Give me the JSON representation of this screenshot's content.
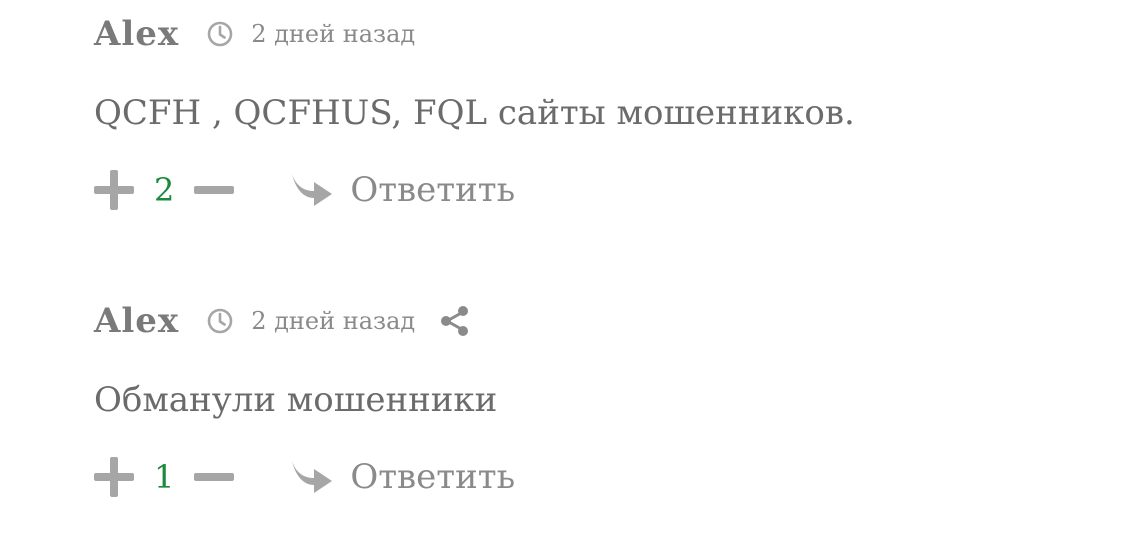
{
  "comments": [
    {
      "author": "Alex",
      "time": "2 дней назад",
      "text": "QCFH , QCFHUS, FQL сайты мошенников.",
      "score": "2",
      "reply_label": "Ответить"
    },
    {
      "author": "Alex",
      "time": "2 дней назад",
      "text": "Обманули мошенники",
      "score": "1",
      "reply_label": "Ответить"
    }
  ],
  "colors": {
    "text": "#6b6b6b",
    "muted": "#8a8a8a",
    "icon": "#a6a6a6",
    "score": "#1a8a3c"
  },
  "icons": {
    "time": "clock-icon",
    "share": "share-icon",
    "upvote": "plus-icon",
    "downvote": "minus-icon",
    "reply": "reply-arrow-icon"
  }
}
